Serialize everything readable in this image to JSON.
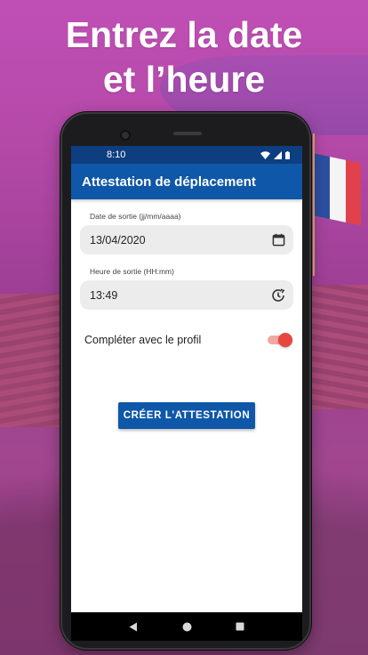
{
  "headline": {
    "line1": "Entrez la date",
    "line2": "et l’heure"
  },
  "status_bar": {
    "time": "8:10",
    "icons": [
      "wifi-icon",
      "signal-icon",
      "battery-icon"
    ]
  },
  "app_bar": {
    "title": "Attestation de déplacement",
    "color": "#0f57a8"
  },
  "form": {
    "date": {
      "label": "Date de sortie (jj/mm/aaaa)",
      "value": "13/04/2020",
      "icon": "calendar-icon"
    },
    "time": {
      "label": "Heure de sortie (HH:mm)",
      "value": "13:49",
      "icon": "clock-icon"
    },
    "profile_toggle": {
      "label": "Compléter avec le profil",
      "checked": true,
      "accent": "#e8473d"
    },
    "create_button": {
      "label": "CRÉER L'ATTESTATION"
    }
  },
  "nav_bar": {
    "buttons": [
      "back-icon",
      "home-icon",
      "recents-icon"
    ]
  },
  "colors": {
    "primary": "#0f57a8",
    "status_bar": "#0d3f80",
    "background_overlay": "#b449a8"
  }
}
